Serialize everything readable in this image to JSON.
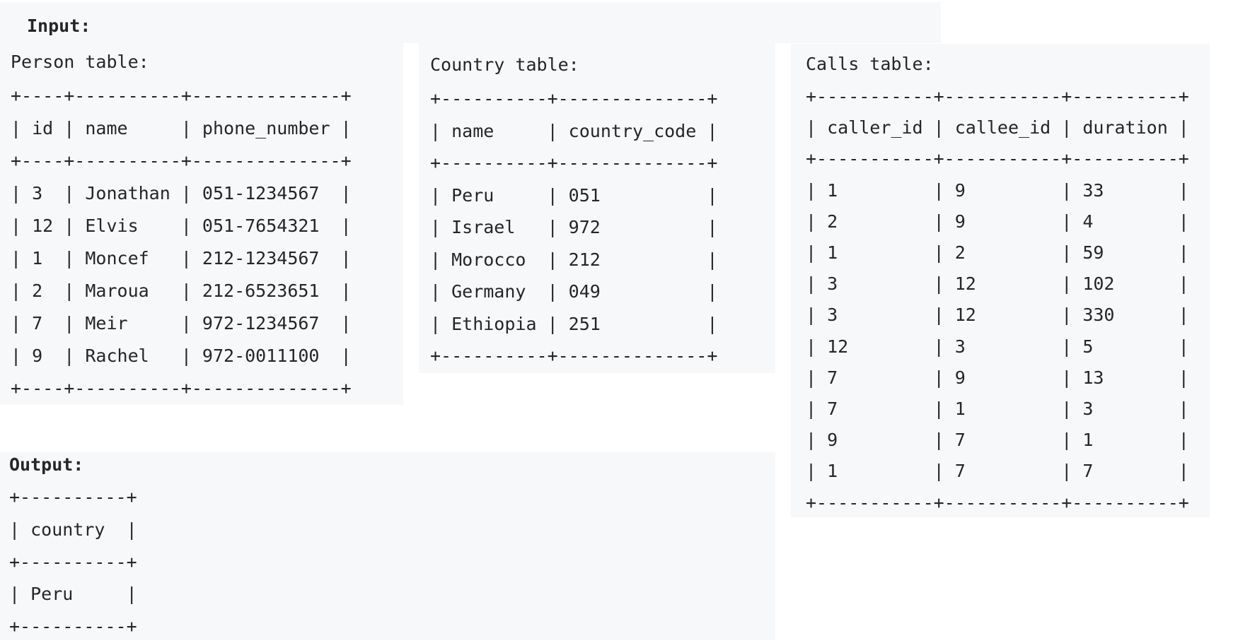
{
  "input_label": "Input:",
  "output_label": "Output:",
  "person": {
    "title": "Person table:",
    "text": "+----+----------+--------------+\n| id | name     | phone_number |\n+----+----------+--------------+\n| 3  | Jonathan | 051-1234567  |\n| 12 | Elvis    | 051-7654321  |\n| 1  | Moncef   | 212-1234567  |\n| 2  | Maroua   | 212-6523651  |\n| 7  | Meir     | 972-1234567  |\n| 9  | Rachel   | 972-0011100  |\n+----+----------+--------------+"
  },
  "country": {
    "title": "Country table:",
    "text": "+----------+--------------+\n| name     | country_code |\n+----------+--------------+\n| Peru     | 051          |\n| Israel   | 972          |\n| Morocco  | 212          |\n| Germany  | 049          |\n| Ethiopia | 251          |\n+----------+--------------+"
  },
  "calls": {
    "title": "Calls table:",
    "text": "+-----------+-----------+----------+\n| caller_id | callee_id | duration |\n+-----------+-----------+----------+\n| 1         | 9         | 33       |\n| 2         | 9         | 4        |\n| 1         | 2         | 59       |\n| 3         | 12        | 102      |\n| 3         | 12        | 330      |\n| 12        | 3         | 5        |\n| 7         | 9         | 13       |\n| 7         | 1         | 3        |\n| 9         | 7         | 1        |\n| 1         | 7         | 7        |\n+-----------+-----------+----------+"
  },
  "output": {
    "text": "+----------+\n| country  |\n+----------+\n| Peru     |\n+----------+"
  }
}
